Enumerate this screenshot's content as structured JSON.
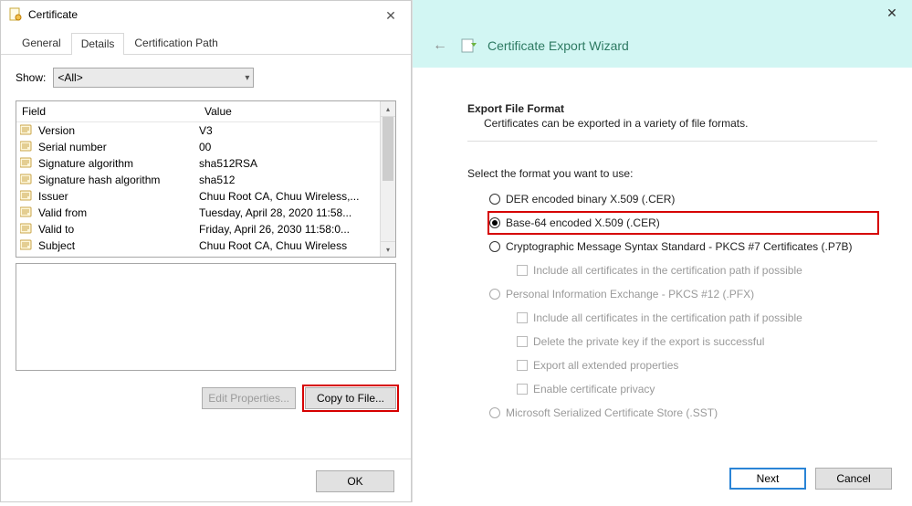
{
  "cert": {
    "title": "Certificate",
    "tabs": {
      "general": "General",
      "details": "Details",
      "path": "Certification Path"
    },
    "show_label": "Show:",
    "show_value": "<All>",
    "cols": {
      "field": "Field",
      "value": "Value"
    },
    "rows": [
      {
        "field": "Version",
        "value": "V3"
      },
      {
        "field": "Serial number",
        "value": "00"
      },
      {
        "field": "Signature algorithm",
        "value": "sha512RSA"
      },
      {
        "field": "Signature hash algorithm",
        "value": "sha512"
      },
      {
        "field": "Issuer",
        "value": "Chuu Root CA, Chuu Wireless,..."
      },
      {
        "field": "Valid from",
        "value": "Tuesday, April 28, 2020 11:58..."
      },
      {
        "field": "Valid to",
        "value": "Friday, April 26, 2030 11:58:0..."
      },
      {
        "field": "Subject",
        "value": "Chuu Root CA, Chuu Wireless"
      }
    ],
    "buttons": {
      "edit": "Edit Properties...",
      "copy": "Copy to File...",
      "ok": "OK"
    }
  },
  "wizard": {
    "title": "Certificate Export Wizard",
    "section_head": "Export File Format",
    "section_sub": "Certificates can be exported in a variety of file formats.",
    "select_label": "Select the format you want to use:",
    "opts": {
      "der": "DER encoded binary X.509 (.CER)",
      "b64": "Base-64 encoded X.509 (.CER)",
      "p7b": "Cryptographic Message Syntax Standard - PKCS #7 Certificates (.P7B)",
      "p7b_sub": "Include all certificates in the certification path if possible",
      "pfx": "Personal Information Exchange - PKCS #12 (.PFX)",
      "pfx_s1": "Include all certificates in the certification path if possible",
      "pfx_s2": "Delete the private key if the export is successful",
      "pfx_s3": "Export all extended properties",
      "pfx_s4": "Enable certificate privacy",
      "sst": "Microsoft Serialized Certificate Store (.SST)"
    },
    "buttons": {
      "next": "Next",
      "cancel": "Cancel"
    }
  }
}
